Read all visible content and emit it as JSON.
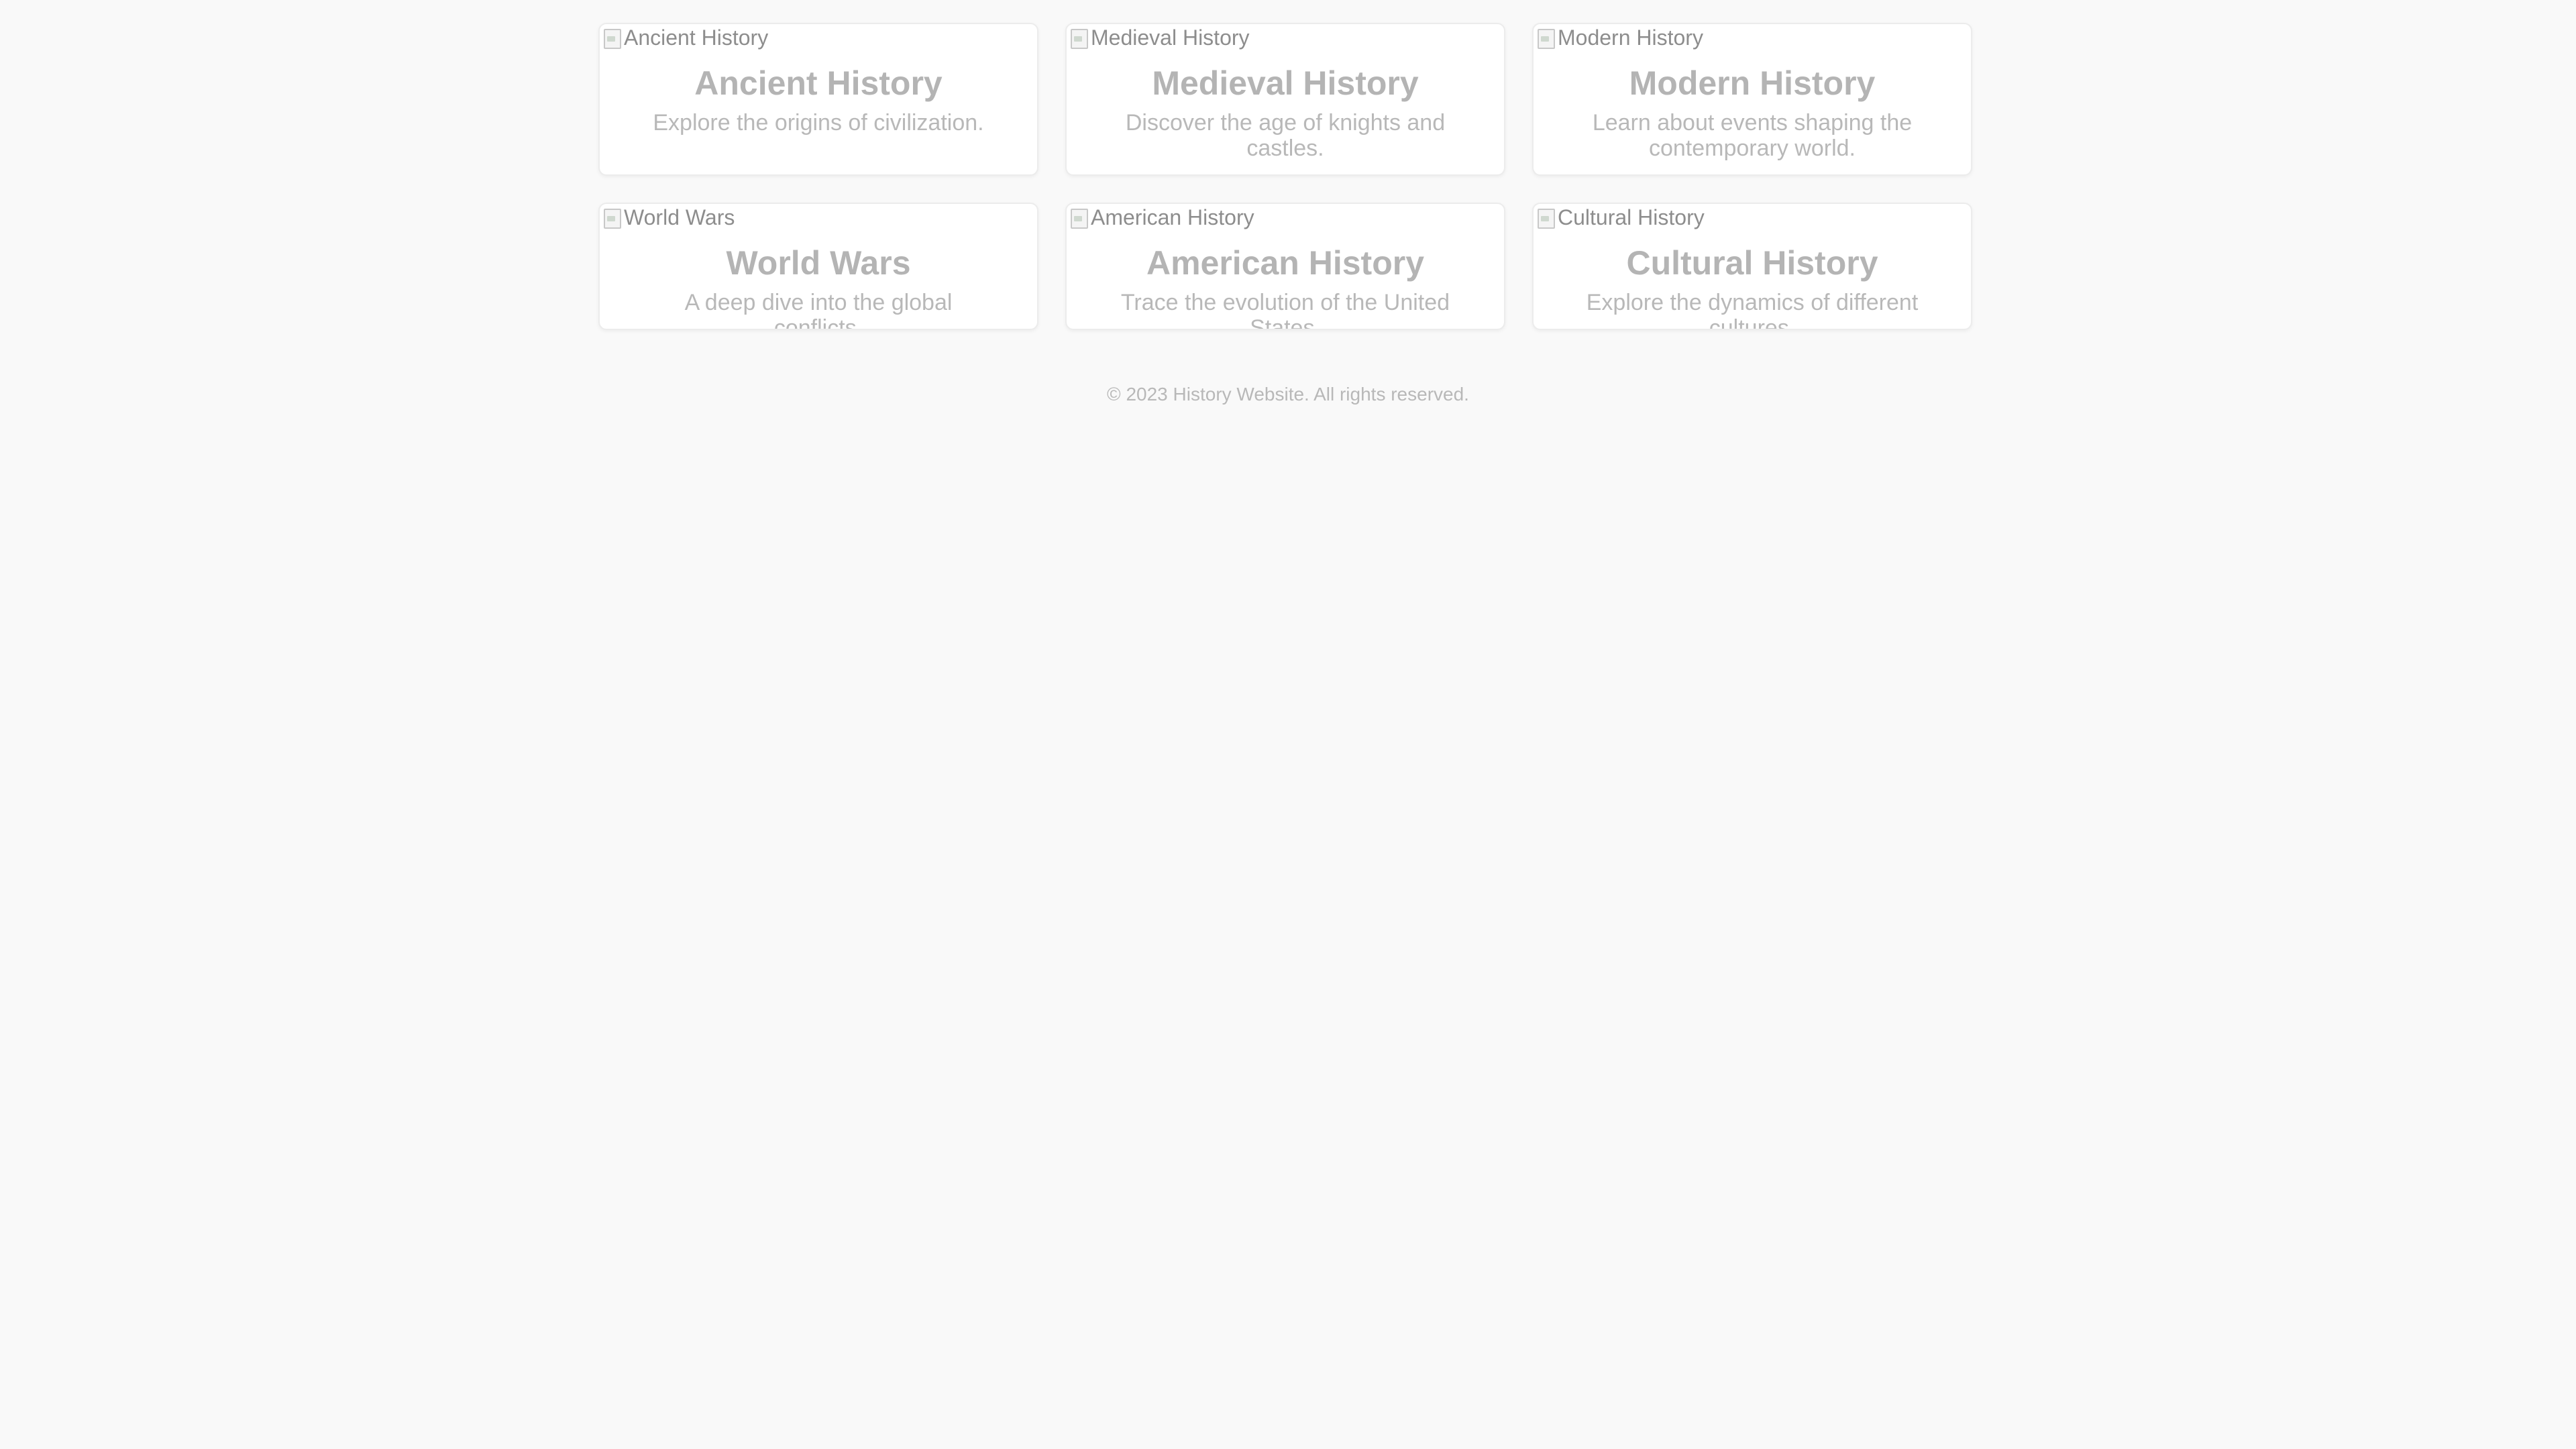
{
  "cards": [
    {
      "image_alt": "Ancient History",
      "title": "Ancient History",
      "description": "Explore the origins of civilization."
    },
    {
      "image_alt": "Medieval History",
      "title": "Medieval History",
      "description": "Discover the age of knights and castles."
    },
    {
      "image_alt": "Modern History",
      "title": "Modern History",
      "description": "Learn about events shaping the contemporary world."
    },
    {
      "image_alt": "World Wars",
      "title": "World Wars",
      "description": "A deep dive into the global conflicts."
    },
    {
      "image_alt": "American History",
      "title": "American History",
      "description": "Trace the evolution of the United States."
    },
    {
      "image_alt": "Cultural History",
      "title": "Cultural History",
      "description": "Explore the dynamics of different cultures."
    }
  ],
  "footer": {
    "text": "© 2023 History Website. All rights reserved."
  },
  "icons": {
    "broken_image": "broken-image-icon"
  },
  "colors": {
    "background": "#f9f9f9",
    "card_background": "#ffffff",
    "title_text": "#b4b4b4",
    "muted_text": "#b8b8b8",
    "alt_text": "#8d8d8d"
  }
}
